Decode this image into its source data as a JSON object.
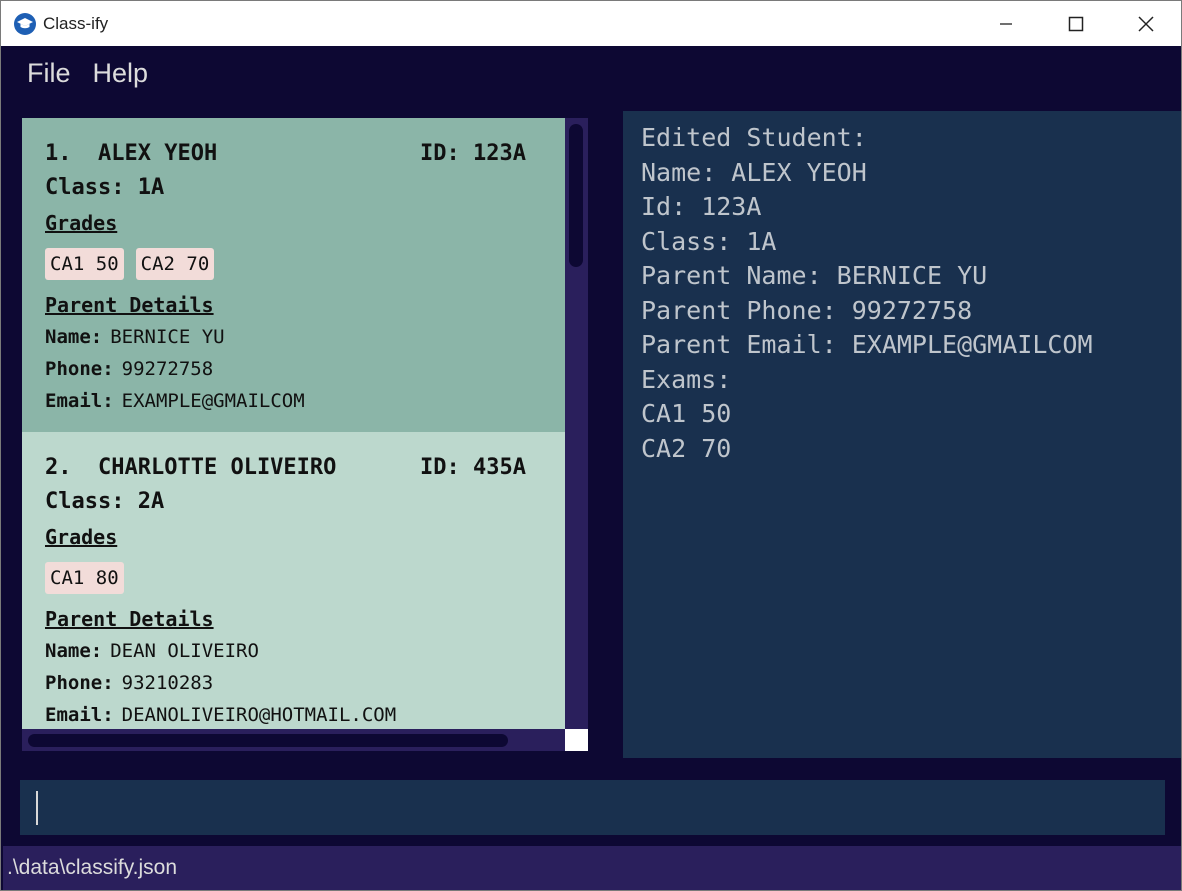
{
  "window": {
    "title": "Class-ify",
    "app_icon": "graduation-cap-icon"
  },
  "menu": {
    "file": "File",
    "help": "Help"
  },
  "students": [
    {
      "index": "1.",
      "name": "ALEX YEOH",
      "id_label": "ID:",
      "id": "123A",
      "class_label": "Class:",
      "class": "1A",
      "grades_title": "Grades",
      "grades": [
        "CA1 50",
        "CA2 70"
      ],
      "parent_title": "Parent Details",
      "parent": {
        "name_label": "Name:",
        "name": "BERNICE YU",
        "phone_label": "Phone:",
        "phone": "99272758",
        "email_label": "Email:",
        "email": "EXAMPLE@GMAILCOM"
      }
    },
    {
      "index": "2.",
      "name": "CHARLOTTE OLIVEIRO",
      "id_label": "ID:",
      "id": "435A",
      "class_label": "Class:",
      "class": "2A",
      "grades_title": "Grades",
      "grades": [
        "CA1 80"
      ],
      "parent_title": "Parent Details",
      "parent": {
        "name_label": "Name:",
        "name": "DEAN OLIVEIRO",
        "phone_label": "Phone:",
        "phone": "93210283",
        "email_label": "Email:",
        "email": "DEANOLIVEIRO@HOTMAIL.COM"
      }
    }
  ],
  "result": {
    "lines": [
      "Edited Student:",
      "Name: ALEX YEOH",
      "Id: 123A",
      "Class: 1A",
      "Parent Name: BERNICE YU",
      "Parent Phone: 99272758",
      "Parent Email: EXAMPLE@GMAILCOM",
      "Exams:",
      "CA1 50",
      "CA2 70"
    ]
  },
  "command": {
    "value": ""
  },
  "status": {
    "path": ".\\data\\classify.json"
  },
  "colors": {
    "background": "#0d0833",
    "selected_card": "#8bb5a8",
    "card": "#bcd8cd",
    "result_panel": "#19304e",
    "grade_tag": "#f2dcd9"
  }
}
